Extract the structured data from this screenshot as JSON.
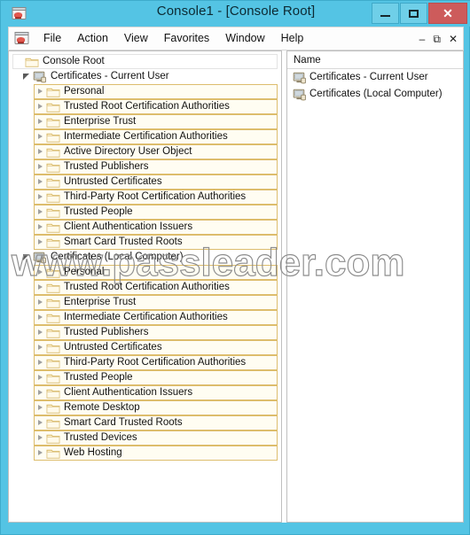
{
  "window": {
    "title": "Console1 - [Console Root]",
    "app_icon": "mmc-console-icon",
    "controls": [
      {
        "name": "minimize-button",
        "glyph": "minimize"
      },
      {
        "name": "maximize-button",
        "glyph": "maximize"
      },
      {
        "name": "close-button",
        "glyph": "✕"
      }
    ],
    "accent_color": "#54c4e4",
    "close_color": "#cd5b5b"
  },
  "menubar": {
    "icon": "mmc-console-icon",
    "items": [
      {
        "label": "File"
      },
      {
        "label": "Action"
      },
      {
        "label": "View"
      },
      {
        "label": "Favorites"
      },
      {
        "label": "Window"
      },
      {
        "label": "Help"
      }
    ],
    "child_controls": [
      {
        "name": "child-minimize-button",
        "glyph": "–"
      },
      {
        "name": "child-restore-button",
        "glyph": "⧉"
      },
      {
        "name": "child-close-button",
        "glyph": "✕"
      }
    ]
  },
  "tree": {
    "root": {
      "label": "Console Root",
      "icon": "folder-icon",
      "level": 0,
      "expander": "none"
    },
    "nodes": [
      {
        "label": "Console Root",
        "icon": "folder-icon",
        "level": 0,
        "expander": "none"
      },
      {
        "label": "Certificates - Current User",
        "icon": "certificate-store-icon",
        "level": 1,
        "expander": "expanded"
      },
      {
        "label": "Personal",
        "icon": "folder-icon",
        "level": 2,
        "expander": "collapsed"
      },
      {
        "label": "Trusted Root Certification Authorities",
        "icon": "folder-icon",
        "level": 2,
        "expander": "collapsed"
      },
      {
        "label": "Enterprise Trust",
        "icon": "folder-icon",
        "level": 2,
        "expander": "collapsed"
      },
      {
        "label": "Intermediate Certification Authorities",
        "icon": "folder-icon",
        "level": 2,
        "expander": "collapsed"
      },
      {
        "label": "Active Directory User Object",
        "icon": "folder-icon",
        "level": 2,
        "expander": "collapsed"
      },
      {
        "label": "Trusted Publishers",
        "icon": "folder-icon",
        "level": 2,
        "expander": "collapsed"
      },
      {
        "label": "Untrusted Certificates",
        "icon": "folder-icon",
        "level": 2,
        "expander": "collapsed"
      },
      {
        "label": "Third-Party Root Certification Authorities",
        "icon": "folder-icon",
        "level": 2,
        "expander": "collapsed"
      },
      {
        "label": "Trusted People",
        "icon": "folder-icon",
        "level": 2,
        "expander": "collapsed"
      },
      {
        "label": "Client Authentication Issuers",
        "icon": "folder-icon",
        "level": 2,
        "expander": "collapsed"
      },
      {
        "label": "Smart Card Trusted Roots",
        "icon": "folder-icon",
        "level": 2,
        "expander": "collapsed"
      },
      {
        "label": "Certificates (Local Computer)",
        "icon": "certificate-store-icon",
        "level": 1,
        "expander": "expanded"
      },
      {
        "label": "Personal",
        "icon": "folder-icon",
        "level": 2,
        "expander": "collapsed"
      },
      {
        "label": "Trusted Root Certification Authorities",
        "icon": "folder-icon",
        "level": 2,
        "expander": "collapsed"
      },
      {
        "label": "Enterprise Trust",
        "icon": "folder-icon",
        "level": 2,
        "expander": "collapsed"
      },
      {
        "label": "Intermediate Certification Authorities",
        "icon": "folder-icon",
        "level": 2,
        "expander": "collapsed"
      },
      {
        "label": "Trusted Publishers",
        "icon": "folder-icon",
        "level": 2,
        "expander": "collapsed"
      },
      {
        "label": "Untrusted Certificates",
        "icon": "folder-icon",
        "level": 2,
        "expander": "collapsed"
      },
      {
        "label": "Third-Party Root Certification Authorities",
        "icon": "folder-icon",
        "level": 2,
        "expander": "collapsed"
      },
      {
        "label": "Trusted People",
        "icon": "folder-icon",
        "level": 2,
        "expander": "collapsed"
      },
      {
        "label": "Client Authentication Issuers",
        "icon": "folder-icon",
        "level": 2,
        "expander": "collapsed"
      },
      {
        "label": "Remote Desktop",
        "icon": "folder-icon",
        "level": 2,
        "expander": "collapsed"
      },
      {
        "label": "Smart Card Trusted Roots",
        "icon": "folder-icon",
        "level": 2,
        "expander": "collapsed"
      },
      {
        "label": "Trusted Devices",
        "icon": "folder-icon",
        "level": 2,
        "expander": "collapsed"
      },
      {
        "label": "Web Hosting",
        "icon": "folder-icon",
        "level": 2,
        "expander": "collapsed"
      }
    ]
  },
  "list": {
    "column_header": "Name",
    "rows": [
      {
        "label": "Certificates - Current User",
        "icon": "certificate-store-icon"
      },
      {
        "label": "Certificates (Local Computer)",
        "icon": "certificate-store-icon"
      }
    ]
  },
  "watermark": {
    "text": "www.passleader.com"
  }
}
